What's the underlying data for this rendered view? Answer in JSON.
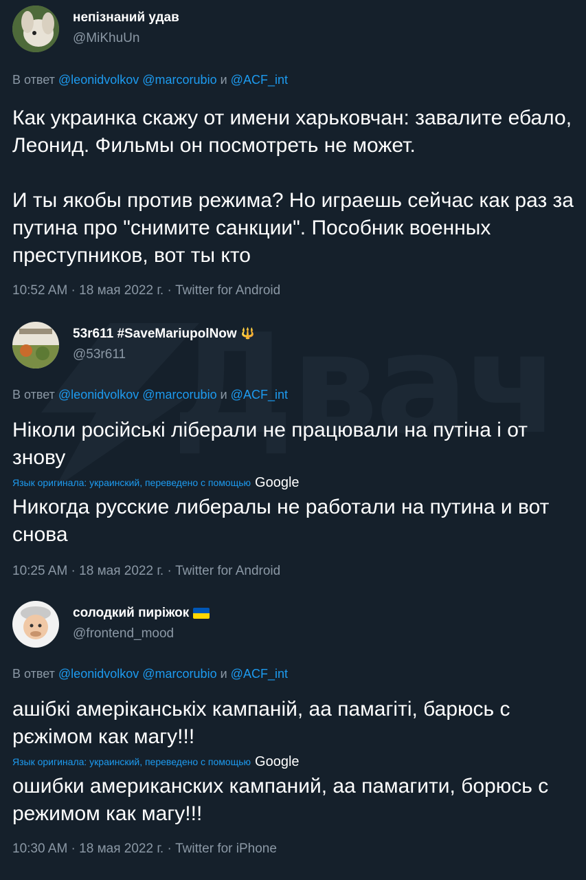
{
  "watermark": "Двач",
  "colors": {
    "background": "#15202b",
    "text": "#ffffff",
    "secondary": "#8b98a5",
    "link": "#1d9bf0"
  },
  "tweets": [
    {
      "display_name": "непізнаний удав",
      "handle": "@MiKhuUn",
      "avatar_icon": "rabbit-avatar-icon",
      "reply_prefix": "В ответ",
      "mention1": "@leonidvolkov",
      "mention2": "@marcorubio",
      "and": "и",
      "mention3": "@ACF_int",
      "text": "Как украинка скажу от имени харьковчан: завалите ебало, Леонид. Фильмы он посмотреть не может.\n\nИ ты якобы против режима? Но играешь сейчас как раз за путина про \"снимите санкции\". Пособник военных преступников, вот ты кто",
      "meta": "10:52 AM · 18 мая 2022 г. · Twitter for Android"
    },
    {
      "display_name": "53r611 #SaveMariupolNow",
      "name_emoji": "🔱",
      "handle": "@53r611",
      "avatar_icon": "painting-avatar-icon",
      "reply_prefix": "В ответ",
      "mention1": "@leonidvolkov",
      "mention2": "@marcorubio",
      "and": "и",
      "mention3": "@ACF_int",
      "text": "Ніколи російські ліберали не працювали на путіна і от знову",
      "translation_note": "Язык оригинала: украинский, переведено с помощью",
      "translation_service": "Google",
      "translated_text": "Никогда русские либералы не работали на путина и вот снова",
      "meta": "10:25 AM · 18 мая 2022 г. · Twitter for Android"
    },
    {
      "display_name": "солодкий пиріжок",
      "flag_icon": "ukraine-flag-icon",
      "handle": "@frontend_mood",
      "avatar_icon": "memoji-avatar-icon",
      "reply_prefix": "В ответ",
      "mention1": "@leonidvolkov",
      "mention2": "@marcorubio",
      "and": "и",
      "mention3": "@ACF_int",
      "text": "ашібкі амеріканськіх кампаній, аа памагіті, барюсь с рєжімом как магу!!!",
      "translation_note": "Язык оригинала: украинский, переведено с помощью",
      "translation_service": "Google",
      "translated_text": "ошибки американских кампаний, аа памагити, борюсь с режимом как магу!!!",
      "meta": "10:30 AM · 18 мая 2022 г. · Twitter for iPhone"
    }
  ]
}
